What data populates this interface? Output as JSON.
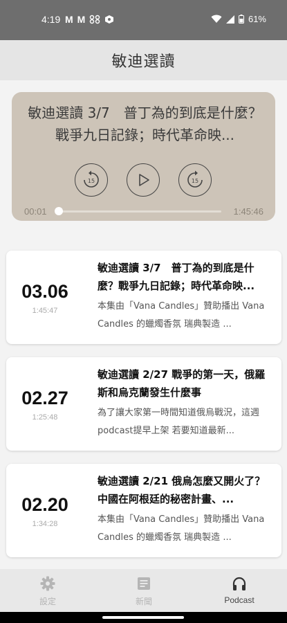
{
  "status_bar": {
    "time": "4:19",
    "left_icons": [
      "gmail-icon",
      "gmail-icon",
      "drone-icon",
      "shield-app-icon"
    ],
    "battery": "61%"
  },
  "header": {
    "title": "敏迪選讀"
  },
  "player": {
    "title": "敏迪選讀 3/7　普丁為的到底是什麼？戰爭九日記錄；時代革命映...",
    "current_time": "00:01",
    "total_time": "1:45:46",
    "progress": 0.0,
    "rewind_label": "15",
    "forward_label": "15",
    "background": "#cdc4b8"
  },
  "episodes": [
    {
      "date": "03.06",
      "duration": "1:45:47",
      "title": "敏迪選讀 3/7　普丁為的到底是什麼？戰爭九日記錄；時代革命映...",
      "desc": "本集由「Vana Candles」贊助播出 Vana Candles 的蠟燭香氛 瑞典製造 ..."
    },
    {
      "date": "02.27",
      "duration": "1:25:48",
      "title": "敏迪選讀 2/27 戰爭的第一天，俄羅斯和烏克蘭發生什麼事",
      "desc": "為了讓大家第一時間知道俄烏戰況，這週podcast提早上架 若要知道最新..."
    },
    {
      "date": "02.20",
      "duration": "1:34:28",
      "title": "敏迪選讀 2/21 俄烏怎麼又開火了？中國在阿根廷的秘密計畫、...",
      "desc": "本集由「Vana Candles」贊助播出 Vana Candles 的蠟燭香氛 瑞典製造 ..."
    }
  ],
  "nav": [
    {
      "label": "設定",
      "icon": "gear-icon",
      "active": false
    },
    {
      "label": "新聞",
      "icon": "news-icon",
      "active": false
    },
    {
      "label": "Podcast",
      "icon": "headphones-icon",
      "active": true
    }
  ]
}
